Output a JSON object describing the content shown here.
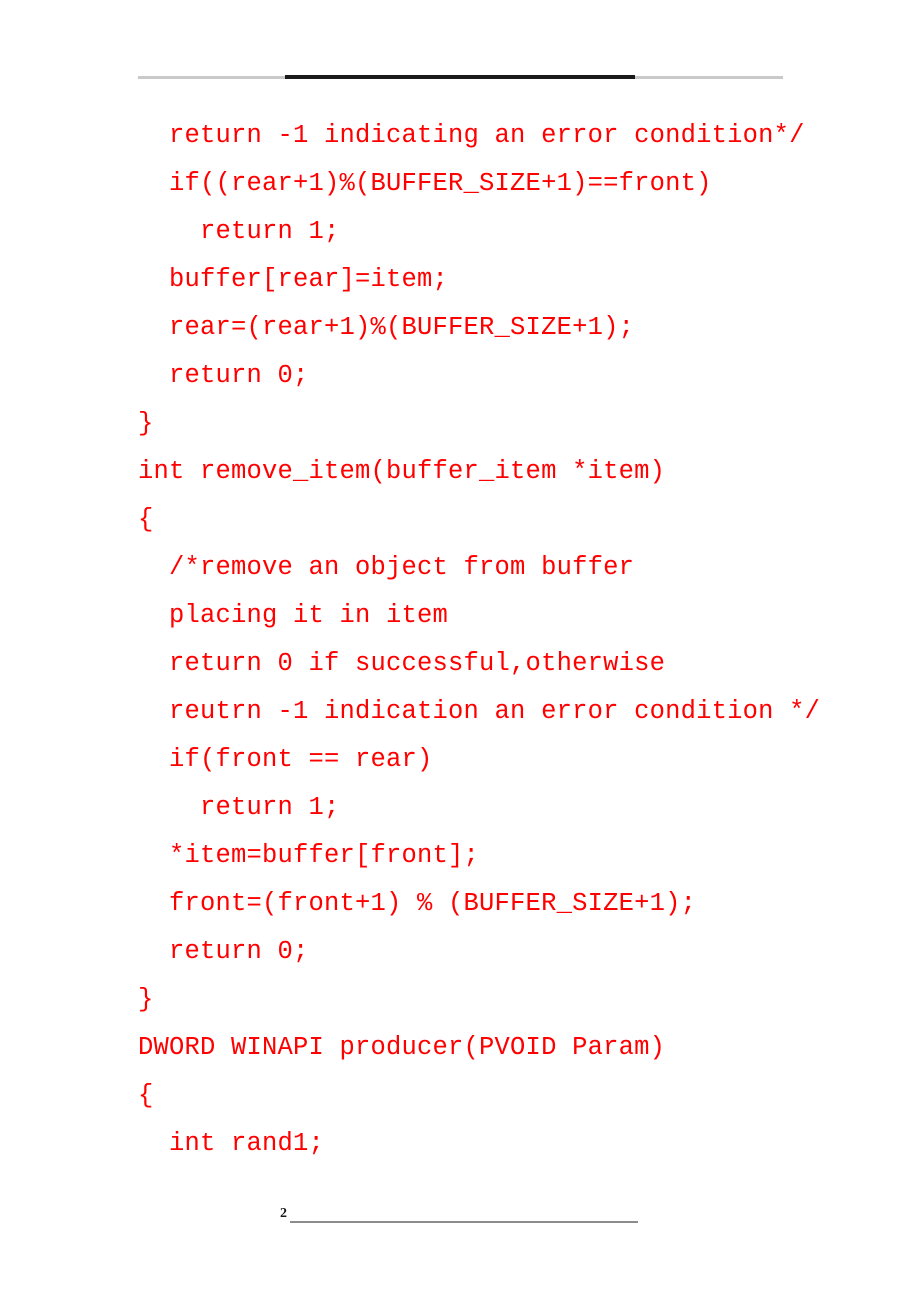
{
  "document": {
    "page_number": "2",
    "text_color": "#ff0000",
    "header_rule_color": "#c9c9c9",
    "header_rule_accent_color": "#1a1a1a",
    "footer_rule_color": "#8c8c8c"
  },
  "code": {
    "lines": [
      "  return -1 indicating an error condition*/",
      "  if((rear+1)%(BUFFER_SIZE+1)==front)",
      "    return 1;",
      "  buffer[rear]=item;",
      "  rear=(rear+1)%(BUFFER_SIZE+1);",
      "  return 0;",
      "}",
      "int remove_item(buffer_item *item)",
      "{",
      "  /*remove an object from buffer",
      "  placing it in item",
      "  return 0 if successful,otherwise",
      "  reutrn -1 indication an error condition */",
      "  if(front == rear)",
      "    return 1;",
      "  *item=buffer[front];",
      "  front=(front+1) % (BUFFER_SIZE+1);",
      "  return 0;",
      "}",
      "DWORD WINAPI producer(PVOID Param)",
      "{",
      "  int rand1;"
    ]
  }
}
